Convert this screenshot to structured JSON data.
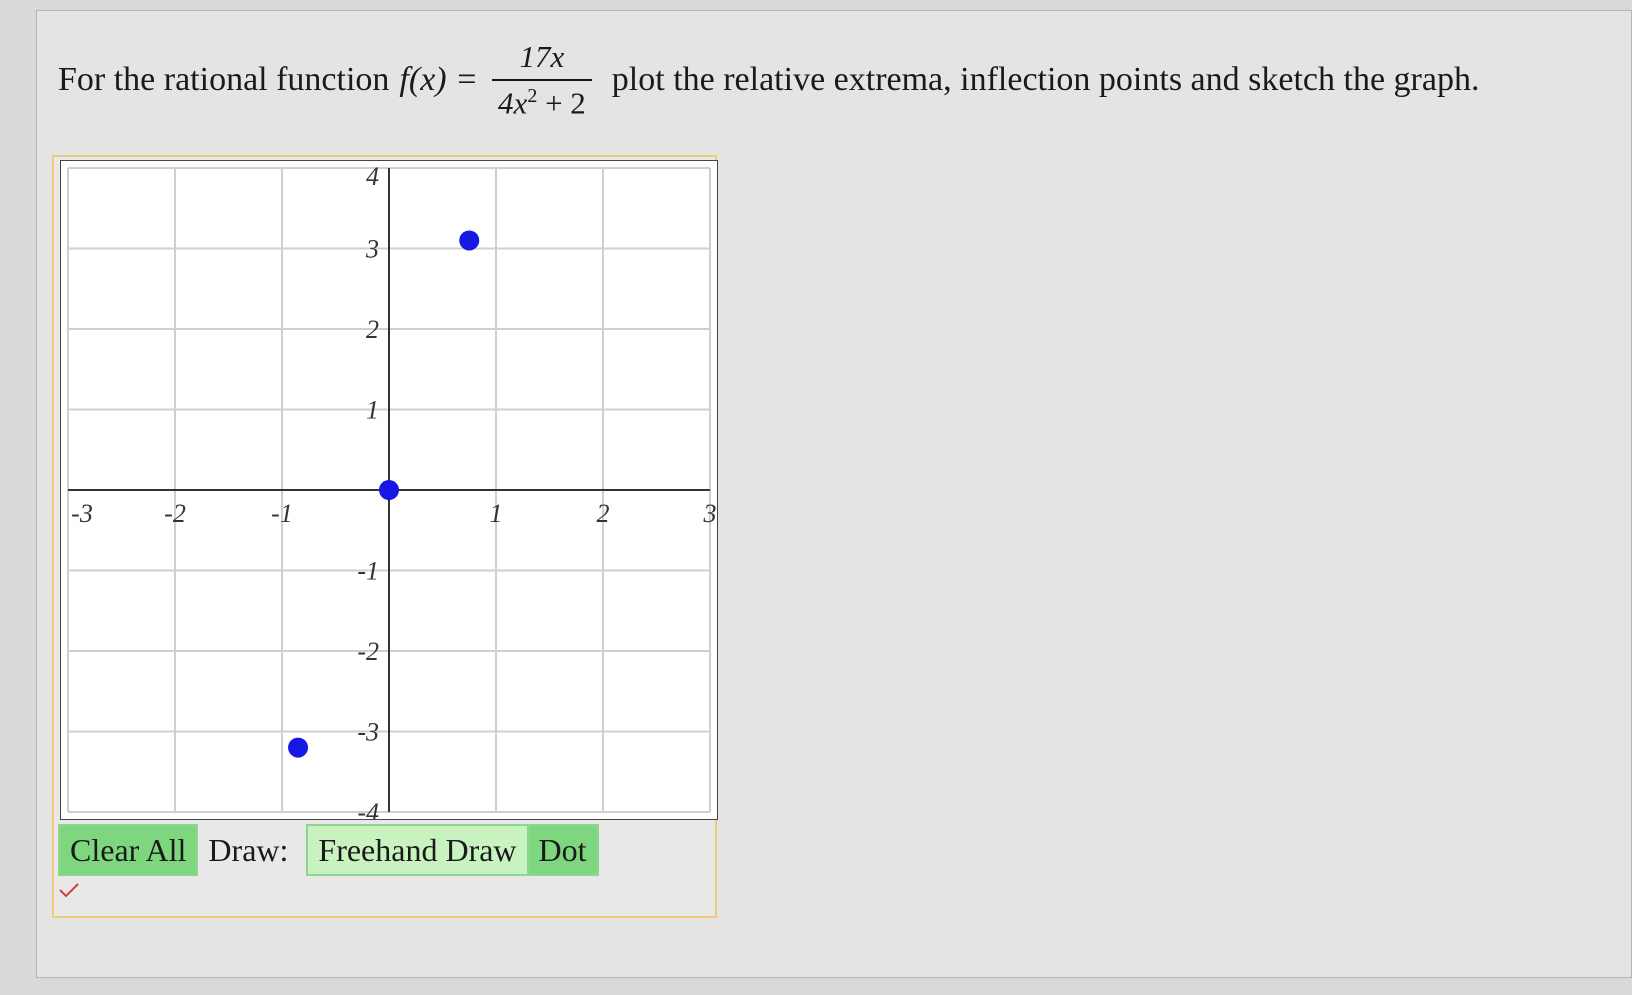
{
  "question": {
    "prefix": "For the rational function",
    "function_name": "f(x) =",
    "numerator": "17x",
    "denominator_base": "4x",
    "denominator_exp": "2",
    "denominator_rest": " + 2",
    "suffix": "plot the relative extrema, inflection points and sketch the graph."
  },
  "graph": {
    "x_ticks": [
      "-3",
      "-2",
      "-1",
      "1",
      "2",
      "3"
    ],
    "y_ticks": [
      "4",
      "3",
      "2",
      "1",
      "-1",
      "-2",
      "-3",
      "-4"
    ],
    "xlim": [
      -3,
      3
    ],
    "ylim": [
      -4,
      4
    ],
    "grid": true,
    "dot_color": "#1717e6",
    "points": [
      {
        "x": 0.75,
        "y": 3.1
      },
      {
        "x": 0,
        "y": 0
      },
      {
        "x": -0.85,
        "y": -3.2
      }
    ]
  },
  "toolbar": {
    "clear_label": "Clear All",
    "draw_label": "Draw:",
    "freehand_label": "Freehand Draw",
    "dot_label": "Dot"
  },
  "status": {
    "icon": "check-icon"
  }
}
